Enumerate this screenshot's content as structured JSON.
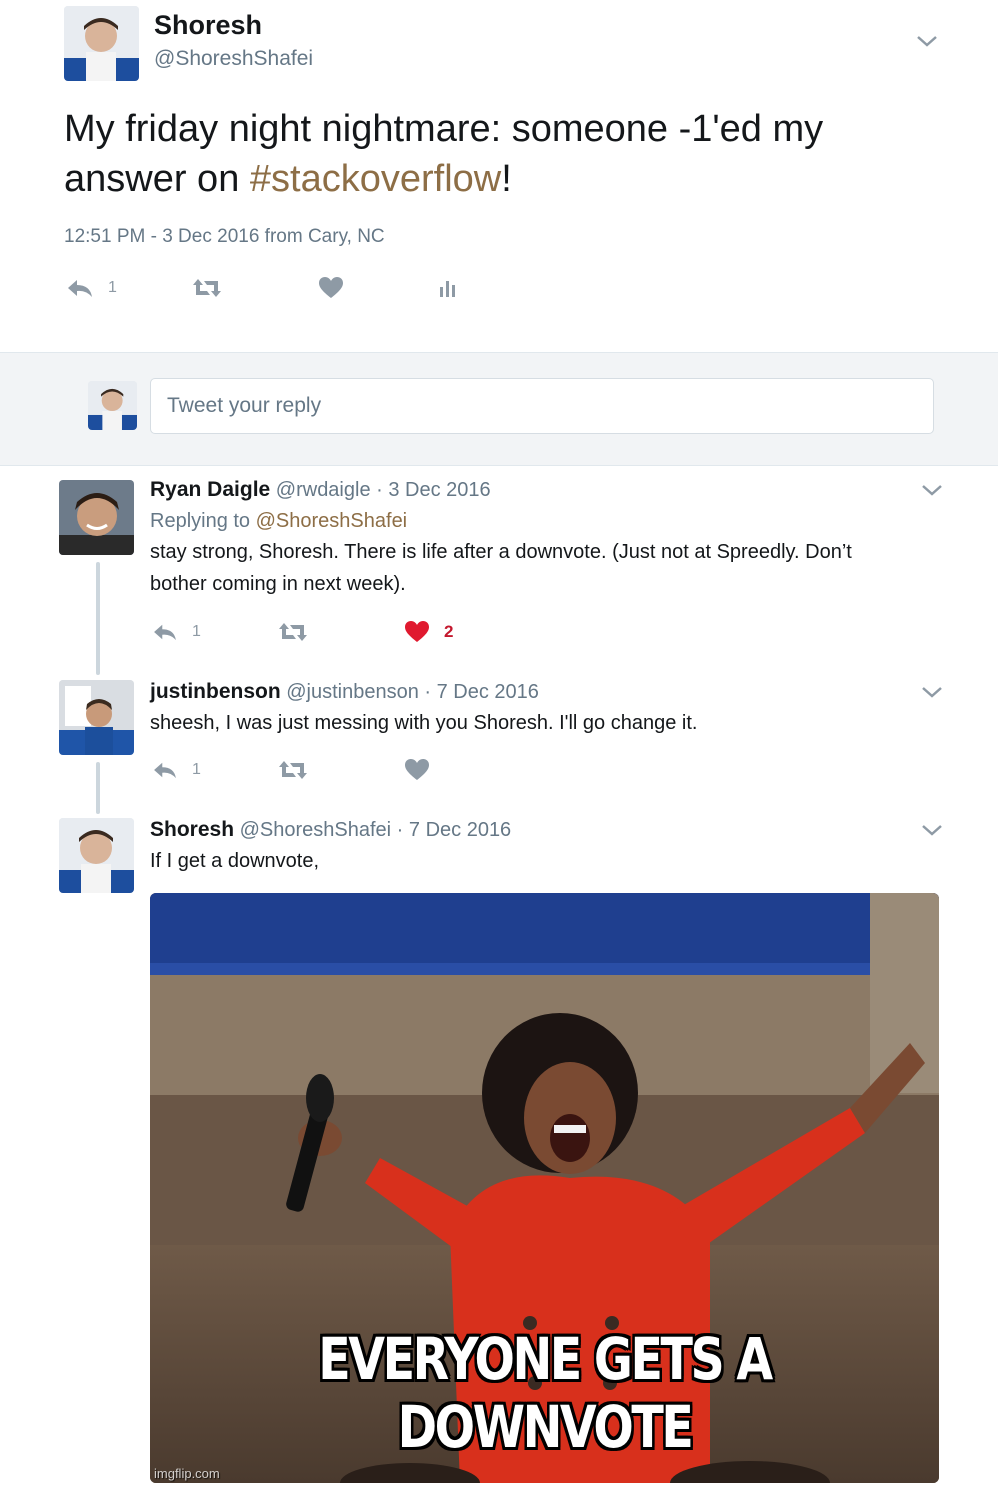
{
  "main_tweet": {
    "author_name": "Shoresh",
    "author_handle": "@ShoreshShafei",
    "text_before": "My friday night nightmare: someone -1'ed my answer on ",
    "hashtag": "#stackoverflow",
    "text_after": "!",
    "meta": "12:51 PM - 3 Dec 2016 from Cary, NC",
    "reply_count": "1",
    "icons": [
      "reply-icon",
      "retweet-icon",
      "heart-icon",
      "analytics-icon",
      "chevron-down-icon"
    ]
  },
  "reply_box": {
    "placeholder": "Tweet your reply"
  },
  "replies": [
    {
      "author_name": "Ryan Daigle",
      "author_handle": "@rwdaigle",
      "date": "· 3 Dec 2016",
      "replying_prefix": "Replying to ",
      "replying_to": "@ShoreshShafei",
      "text_line1": "stay strong, Shoresh. There is life after a downvote. (Just not at Spreedly. Don’t",
      "text_line2": "bother coming in next week).",
      "reply_count": "1",
      "like_count": "2",
      "liked": true
    },
    {
      "author_name": "justinbenson",
      "author_handle": "@justinbenson",
      "date": "· 7 Dec 2016",
      "text_line1": "sheesh, I was just messing with you Shoresh. I'll go change it.",
      "reply_count": "1",
      "liked": false
    },
    {
      "author_name": "Shoresh",
      "author_handle": "@ShoreshShafei",
      "date": "· 7 Dec 2016",
      "text_line1": "If I get a downvote,",
      "media": {
        "caption": "EVERYONE GETS A DOWNVOTE",
        "watermark": "imgflip.com"
      }
    }
  ],
  "colors": {
    "text": "#14171a",
    "secondary": "#657786",
    "hashtag": "#8d6e46",
    "like_red": "#c4182e",
    "icon_gray": "#8e9aa5"
  }
}
